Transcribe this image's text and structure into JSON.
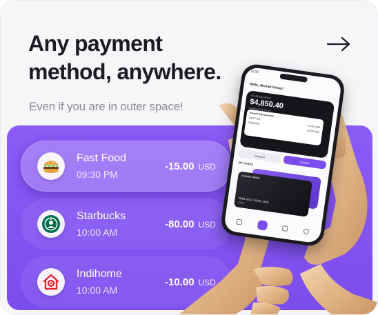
{
  "headline": {
    "line1": "Any payment",
    "line2": "method, anywhere."
  },
  "subtitle": "Even if you are in outer space!",
  "accent_color": "#8b5cf6",
  "nav": {
    "next_icon": "arrow-right-icon"
  },
  "transactions": [
    {
      "name": "Fast Food",
      "time": "09:30 PM",
      "amount": "-15.00",
      "currency": "USD",
      "icon": "burger-icon",
      "active": true
    },
    {
      "name": "Starbucks",
      "time": "10:00 AM",
      "amount": "-80.00",
      "currency": "USD",
      "icon": "starbucks-logo-icon",
      "active": false
    },
    {
      "name": "Indihome",
      "time": "10:00 AM",
      "amount": "-10.00",
      "currency": "USD",
      "icon": "indihome-logo-icon",
      "active": false
    }
  ],
  "phone": {
    "status_time": "12:30",
    "greeting": "Hello, Ahmad Dimas!",
    "balance_label": "YOUR BALANCE",
    "balance": "$4,850.40",
    "balance_sub": "Cashback $1,550.00",
    "recent_title": "Recent Transactions",
    "recent": [
      {
        "name": "Fast Food",
        "amount": "-15.00 USD"
      },
      {
        "name": "Starbucks",
        "amount": "-80.00 USD"
      }
    ],
    "request_label": "Request",
    "transfer_label": "Transfer",
    "cards_label": "MY CARDS",
    "card_holder": "AHMAD DIMAS",
    "card_number": "7908 0012 8290 1168",
    "card_expiry": "12/26"
  }
}
